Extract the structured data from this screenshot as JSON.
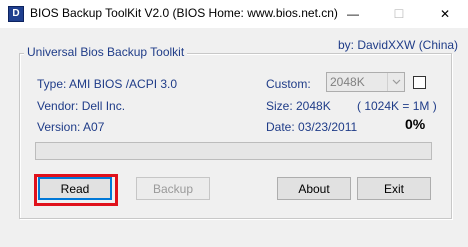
{
  "window": {
    "title": "BIOS Backup ToolKit V2.0 (BIOS Home: www.bios.net.cn)",
    "icon_name": "app-icon",
    "controls": {
      "minimize_glyph": "—",
      "maximize_glyph": "☐",
      "close_glyph": "✕"
    }
  },
  "group": {
    "legend": "Universal Bios Backup Toolkit",
    "byline": "by: DavidXXW   (China)"
  },
  "info": {
    "type": "Type: AMI BIOS  /ACPI 3.0",
    "vendor": "Vendor: Dell Inc.",
    "version": "Version: A07",
    "custom_label": "Custom:",
    "size": "Size: 2048K",
    "size_detail": "( 1024K = 1M )",
    "date": "Date: 03/23/2011",
    "percent": "0%"
  },
  "custom": {
    "selected": "2048K",
    "enabled": false,
    "checked": false
  },
  "progress": {
    "value": 0
  },
  "buttons": {
    "read": "Read",
    "backup": "Backup",
    "about": "About",
    "exit": "Exit"
  },
  "colors": {
    "label_text": "#1f3c88",
    "highlight": "#e0111b",
    "focus_border": "#0078d7"
  }
}
